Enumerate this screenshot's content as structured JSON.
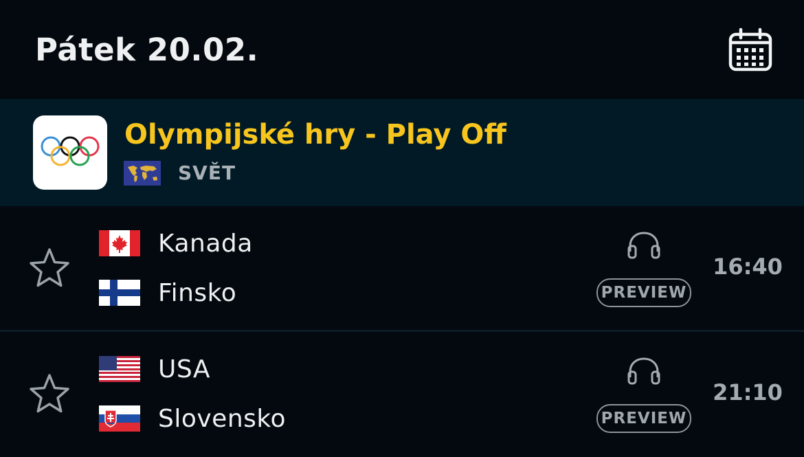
{
  "header": {
    "date_title": "Pátek 20.02.",
    "calendar_icon": "calendar-icon"
  },
  "league": {
    "name": "Olympijské hry - Play Off",
    "region": "SVĚT",
    "logo_icon": "olympic-rings-icon",
    "region_icon": "world-map-flag-icon",
    "name_color": "#f7c51e"
  },
  "matches": [
    {
      "home": "Kanada",
      "away": "Finsko",
      "home_flag": "canada-flag-icon",
      "away_flag": "finland-flag-icon",
      "audio_icon": "headphones-icon",
      "preview_label": "PREVIEW",
      "time": "16:40"
    },
    {
      "home": "USA",
      "away": "Slovensko",
      "home_flag": "usa-flag-icon",
      "away_flag": "slovakia-flag-icon",
      "audio_icon": "headphones-icon",
      "preview_label": "PREVIEW",
      "time": "21:10"
    }
  ]
}
